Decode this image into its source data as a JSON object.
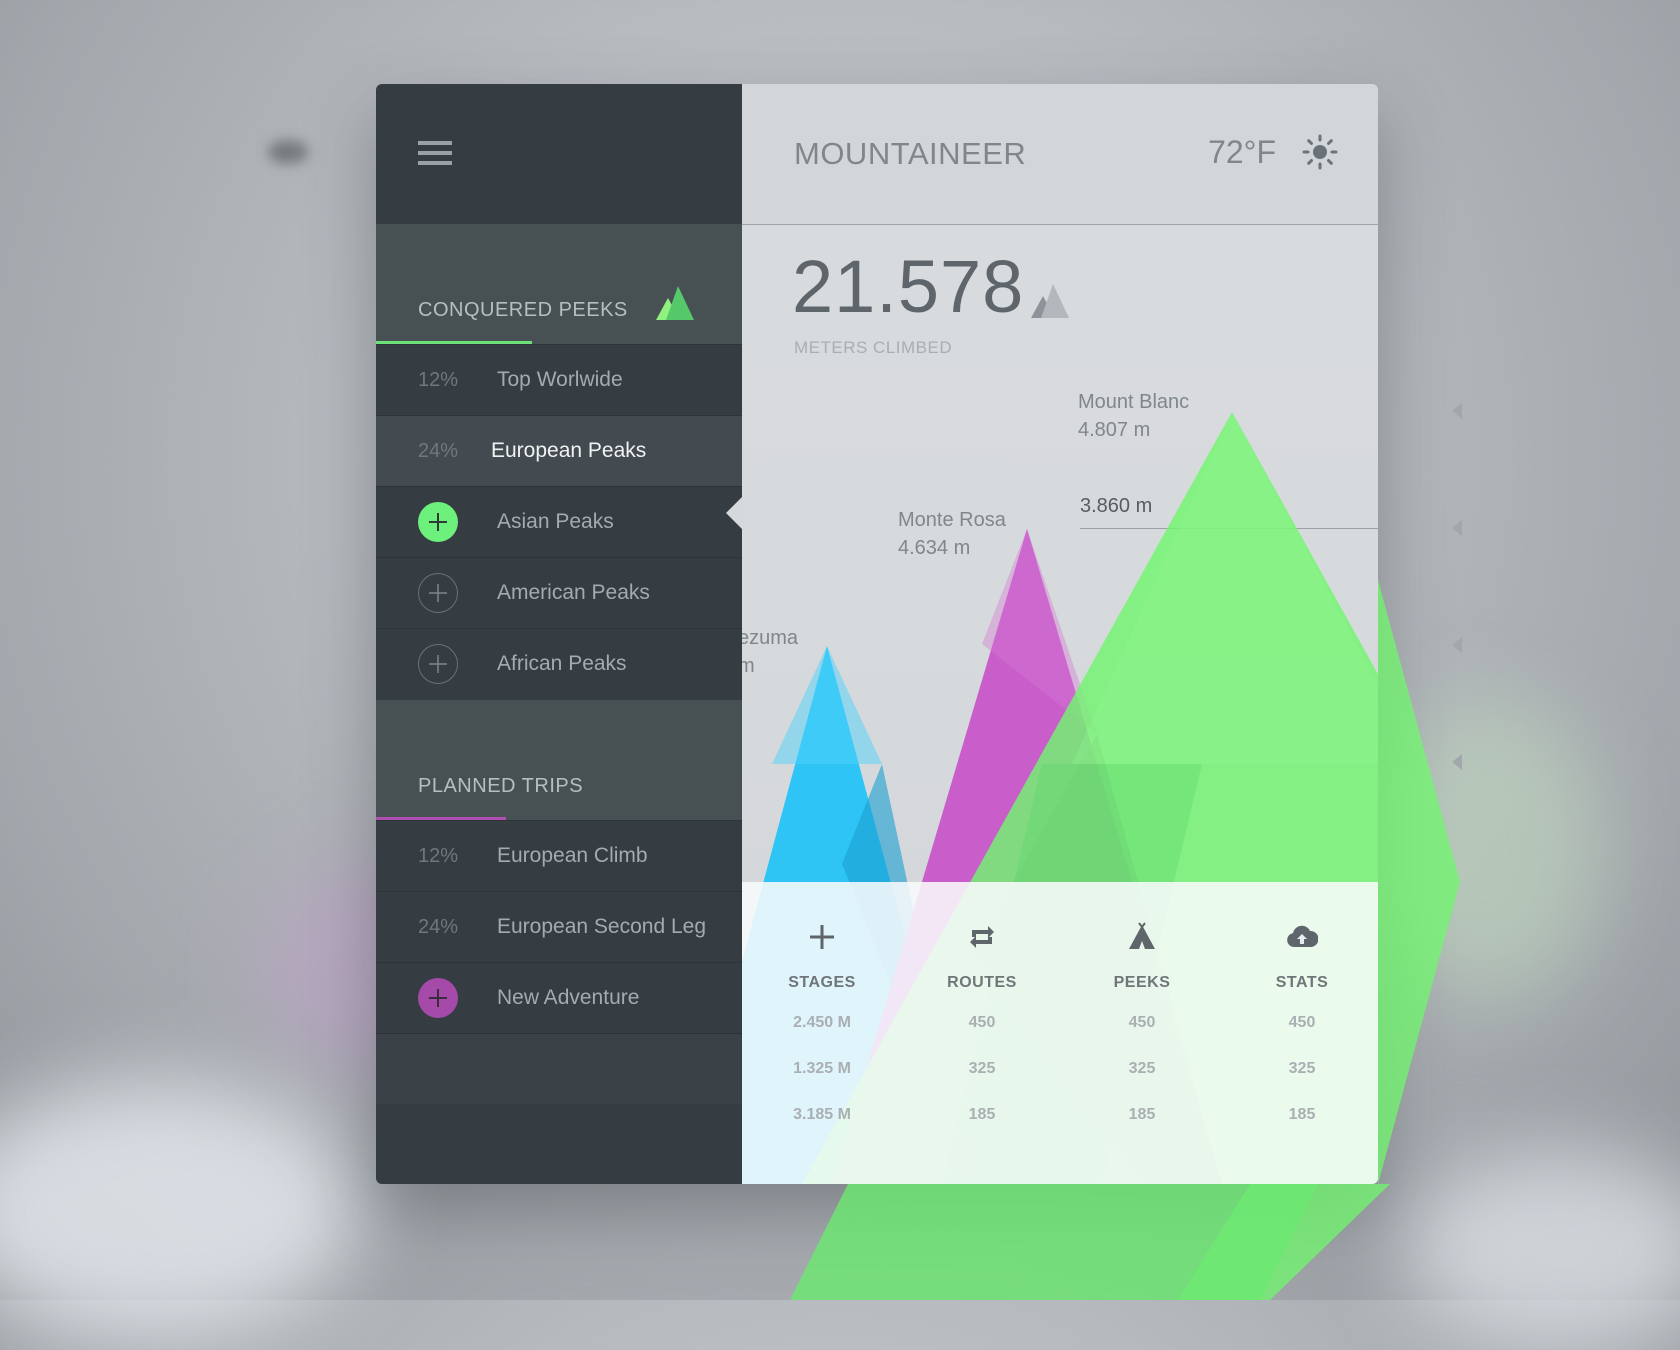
{
  "app": {
    "title": "MOUNTAINEER",
    "temperature": "72°F",
    "weather_icon": "sun-icon"
  },
  "summary": {
    "value": "21.578",
    "caption": "METERS CLIMBED"
  },
  "sidebar": {
    "conquered": {
      "title": "CONQUERED PEEKS",
      "accent": "#6ee07a",
      "items": [
        {
          "pct": "12%",
          "label": "Top Worlwide"
        },
        {
          "pct": "24%",
          "label": "European Peaks"
        },
        {
          "pct": "",
          "label": "Asian Peaks"
        },
        {
          "pct": "",
          "label": "American Peaks"
        },
        {
          "pct": "",
          "label": "African Peaks"
        }
      ]
    },
    "planned": {
      "title": "PLANNED TRIPS",
      "accent": "#b04fb2",
      "items": [
        {
          "pct": "12%",
          "label": "European Climb"
        },
        {
          "pct": "24%",
          "label": "European Second Leg"
        },
        {
          "pct": "",
          "label": "New Adventure"
        }
      ]
    }
  },
  "peaks": {
    "mount_blanc": {
      "name": "Mount Blanc",
      "height": "4.807 m"
    },
    "monte_rosa": {
      "name": "Monte Rosa",
      "height": "4.634 m"
    },
    "montezuma": {
      "name": "ezuma",
      "height": "m"
    },
    "guide": "3.860 m",
    "colors": {
      "blue": "#25c4f7",
      "purple": "#c857c9",
      "green": "#72f56f"
    }
  },
  "stats": {
    "columns": [
      {
        "title": "STAGES",
        "icon": "plus-icon",
        "values": [
          "2.450 M",
          "1.325 M",
          "3.185 M"
        ]
      },
      {
        "title": "ROUTES",
        "icon": "repeat-icon",
        "values": [
          "450",
          "325",
          "185"
        ]
      },
      {
        "title": "PEEKS",
        "icon": "tent-icon",
        "values": [
          "450",
          "325",
          "185"
        ]
      },
      {
        "title": "STATS",
        "icon": "cloud-upload-icon",
        "values": [
          "450",
          "325",
          "185"
        ]
      }
    ]
  }
}
